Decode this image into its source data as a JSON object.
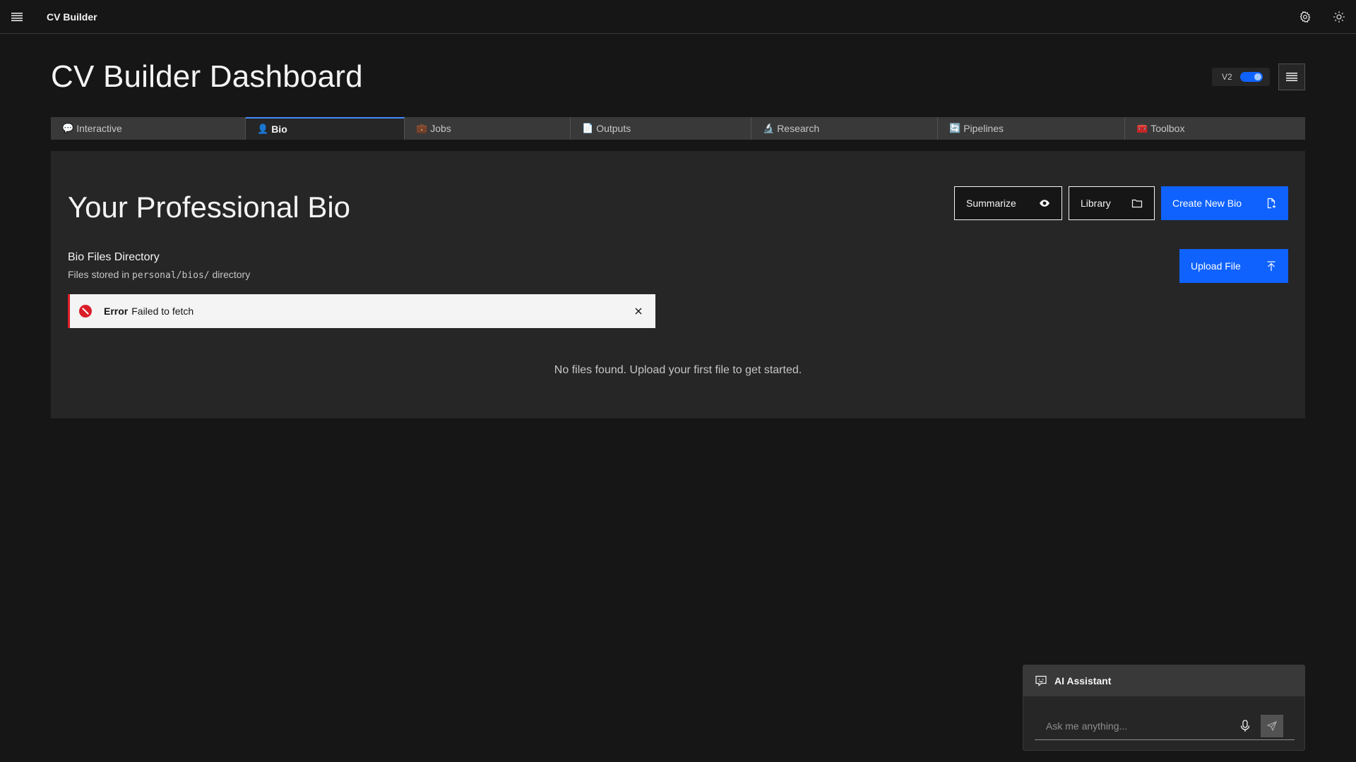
{
  "header": {
    "app_name": "CV Builder",
    "menu_icon": "hamburger-menu-icon",
    "settings_icon": "gear-icon",
    "theme_icon": "sun-icon"
  },
  "page": {
    "title": "CV Builder Dashboard",
    "version_label": "V2",
    "version_toggle_on": true
  },
  "tabs": [
    {
      "icon": "💬",
      "label": "Interactive",
      "active": false
    },
    {
      "icon": "👤",
      "label": "Bio",
      "active": true
    },
    {
      "icon": "💼",
      "label": "Jobs",
      "active": false
    },
    {
      "icon": "📄",
      "label": "Outputs",
      "active": false
    },
    {
      "icon": "🔬",
      "label": "Research",
      "active": false
    },
    {
      "icon": "🔄",
      "label": "Pipelines",
      "active": false
    },
    {
      "icon": "🧰",
      "label": "Toolbox",
      "active": false
    }
  ],
  "bio": {
    "title": "Your Professional Bio",
    "summarize_label": "Summarize",
    "library_label": "Library",
    "create_label": "Create New Bio",
    "directory_title": "Bio Files Directory",
    "directory_prefix": "Files stored in",
    "directory_path": "personal/bios/",
    "directory_suffix": "directory",
    "upload_label": "Upload File",
    "error_title": "Error",
    "error_message": "Failed to fetch",
    "empty_message": "No files found. Upload your first file to get started."
  },
  "assistant": {
    "title": "AI Assistant",
    "placeholder": "Ask me anything..."
  },
  "colors": {
    "background": "#161616",
    "panel": "#262626",
    "primary": "#0f62fe",
    "error": "#da1e28",
    "tab_active_border": "#4589ff"
  }
}
